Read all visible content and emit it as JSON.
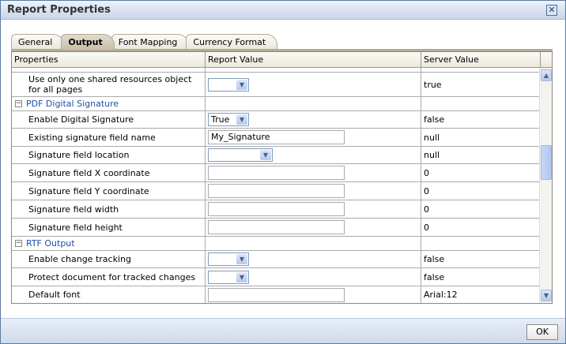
{
  "title": "Report Properties",
  "tabs": [
    "General",
    "Output",
    "Font Mapping",
    "Currency Format"
  ],
  "columns": [
    "Properties",
    "Report Value",
    "Server Value"
  ],
  "rows": {
    "r0": {
      "label": "Use only one shared resources object for all pages",
      "server": "true"
    },
    "g1": "PDF Digital Signature",
    "r1": {
      "label": "Enable Digital Signature",
      "value": "True",
      "server": "false"
    },
    "r2": {
      "label": "Existing signature field name",
      "value": "My_Signature",
      "server": "null"
    },
    "r3": {
      "label": "Signature field location",
      "server": "null"
    },
    "r4": {
      "label": "Signature field X coordinate",
      "server": "0"
    },
    "r5": {
      "label": "Signature field Y coordinate",
      "server": "0"
    },
    "r6": {
      "label": "Signature field width",
      "server": "0"
    },
    "r7": {
      "label": "Signature field height",
      "server": "0"
    },
    "g2": "RTF Output",
    "r8": {
      "label": "Enable change tracking",
      "server": "false"
    },
    "r9": {
      "label": "Protect document for tracked changes",
      "server": "false"
    },
    "r10": {
      "label": "Default font",
      "server": "Arial:12"
    }
  },
  "ok_label": "OK",
  "expand_glyph": "−"
}
